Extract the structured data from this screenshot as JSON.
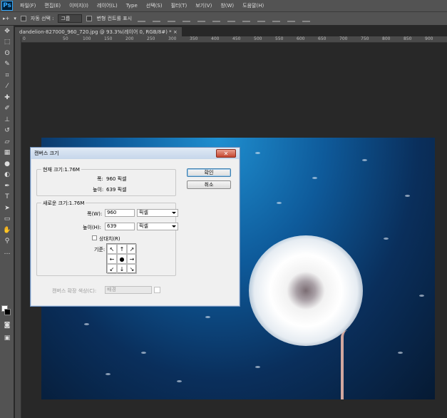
{
  "app": {
    "logo": "Ps"
  },
  "menu": [
    "파일(F)",
    "편집(E)",
    "이미지(I)",
    "레이어(L)",
    "Type",
    "선택(S)",
    "필터(T)",
    "보기(V)",
    "창(W)",
    "도움말(H)"
  ],
  "options": {
    "auto_select_label": "자동 선택 :",
    "auto_select_value": "그룹",
    "show_transform_label": "변형 컨트롤 표시"
  },
  "document": {
    "tab_title": "dandelion-827000_960_720.jpg @ 93.3%(레이어 0, RGB/8#) *",
    "tab_close": "×"
  },
  "ruler": {
    "ticks": [
      "0",
      "50",
      "100",
      "150",
      "200",
      "250",
      "300",
      "350",
      "400",
      "450",
      "500",
      "550",
      "600",
      "650",
      "700",
      "750",
      "800",
      "850",
      "900"
    ]
  },
  "dialog": {
    "title": "캔버스 크기",
    "close": "✕",
    "current_size": {
      "label": "현재 크기:1.76M",
      "width_label": "폭:",
      "width_value": "960 픽셀",
      "height_label": "높이:",
      "height_value": "639 픽셀"
    },
    "new_size": {
      "label": "새로운 크기:1.76M",
      "width_label": "폭(W):",
      "width_value": "960",
      "width_unit": "픽셀",
      "height_label": "높이(H):",
      "height_value": "639",
      "height_unit": "픽셀",
      "relative_label": "상대치(R)",
      "anchor_label": "기준:",
      "anchor_arrows": [
        "↖",
        "↑",
        "↗",
        "←",
        "●",
        "→",
        "↙",
        "↓",
        "↘"
      ]
    },
    "extension_color_label": "캔버스 확장 색상(C):",
    "extension_color_value": "배경",
    "ok_label": "확인",
    "cancel_label": "취소"
  }
}
